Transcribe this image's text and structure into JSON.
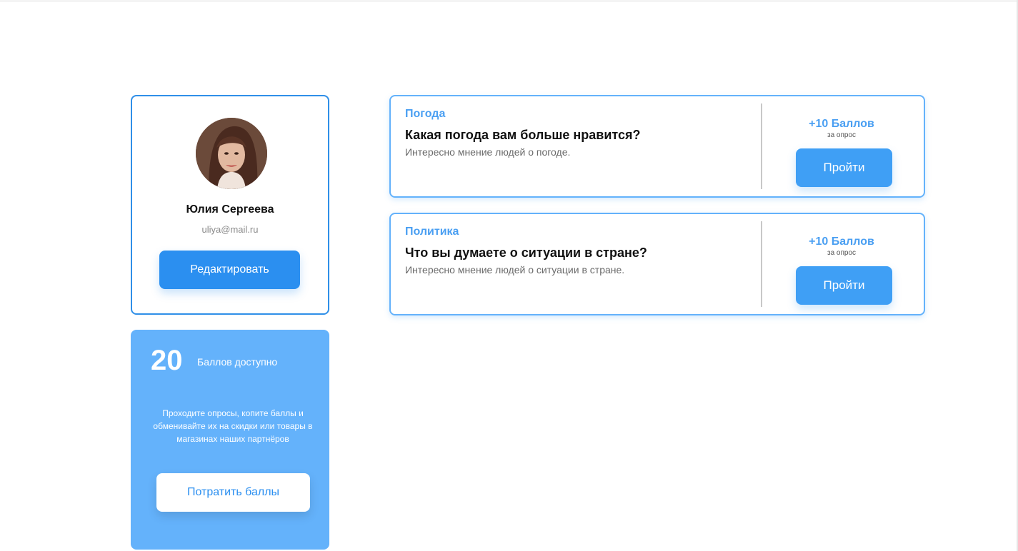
{
  "profile": {
    "name": "Юлия Сергеева",
    "email": "uliya@mail.ru",
    "edit_label": "Редактировать"
  },
  "points": {
    "count": "20",
    "label": "Баллов доступно",
    "description": "Проходите опросы, копите баллы и обменивайте их на скидки или товары в магазинах наших партнёров",
    "spend_label": "Потратить баллы"
  },
  "surveys": [
    {
      "category": "Погода",
      "question": "Какая погода вам больше нравится?",
      "description": "Интересно мнение людей о погоде.",
      "reward": "+10 Баллов",
      "reward_sub": "за опрос",
      "action_label": "Пройти"
    },
    {
      "category": "Политика",
      "question": "Что вы думаете о ситуации в стране?",
      "description": "Интересно мнение людей о ситуации в стране.",
      "reward": "+10 Баллов",
      "reward_sub": "за опрос",
      "action_label": "Пройти"
    }
  ],
  "colors": {
    "primary": "#2b8ff0",
    "card_blue": "#64b2fb",
    "accent_text": "#4a9ff2"
  }
}
